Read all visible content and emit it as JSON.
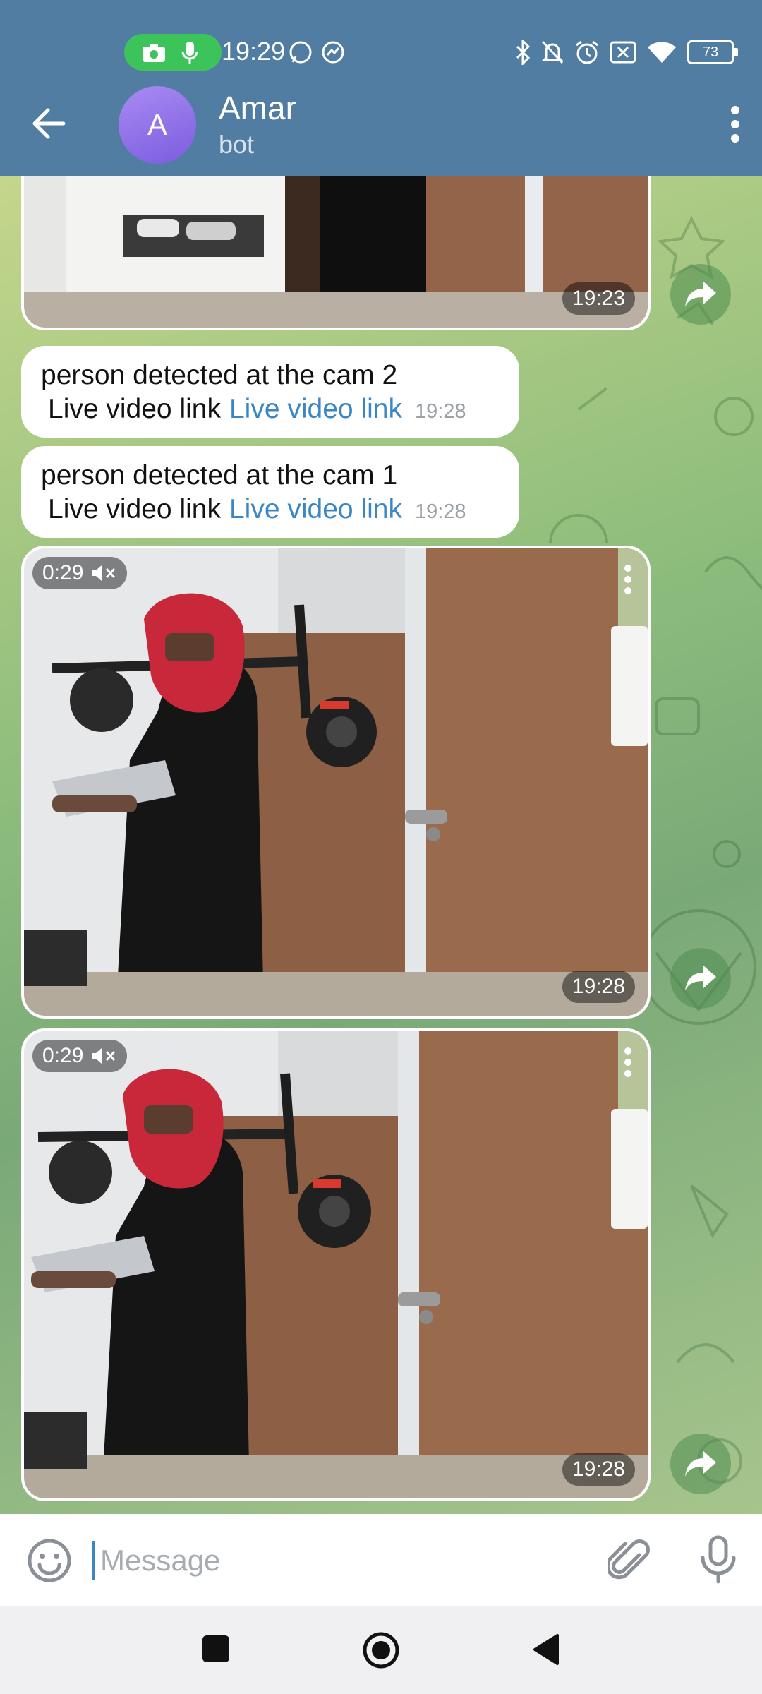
{
  "status": {
    "time": "19:29",
    "battery": "73"
  },
  "header": {
    "avatar_letter": "A",
    "title": "Amar",
    "subtitle": "bot"
  },
  "messages": {
    "first_media": {
      "time": "19:23"
    },
    "text1": {
      "line1": "person detected at the cam 2",
      "plain": "Live video link",
      "link": "Live video link",
      "time": "19:28"
    },
    "text2": {
      "line1": "person detected at the cam 1",
      "plain": "Live video link",
      "link": "Live video link",
      "time": "19:28"
    },
    "video1": {
      "duration": "0:29",
      "time": "19:28"
    },
    "video2": {
      "duration": "0:29",
      "time": "19:28"
    }
  },
  "composer": {
    "placeholder": "Message"
  },
  "colors": {
    "header": "#527da3",
    "link": "#3a86c4",
    "status_pill": "#3cc35a",
    "avatar": "#8b6de6"
  },
  "icons": [
    "camera-icon",
    "mic-icon",
    "whatsapp-icon",
    "messenger-icon",
    "bluetooth-icon",
    "bell-off-icon",
    "alarm-icon",
    "close-box-icon",
    "wifi-icon",
    "battery-icon",
    "back-arrow-icon",
    "more-vert-icon",
    "share-icon",
    "mute-icon",
    "emoji-icon",
    "attach-icon",
    "mic-icon",
    "nav-square-icon",
    "nav-home-icon",
    "nav-back-icon"
  ]
}
